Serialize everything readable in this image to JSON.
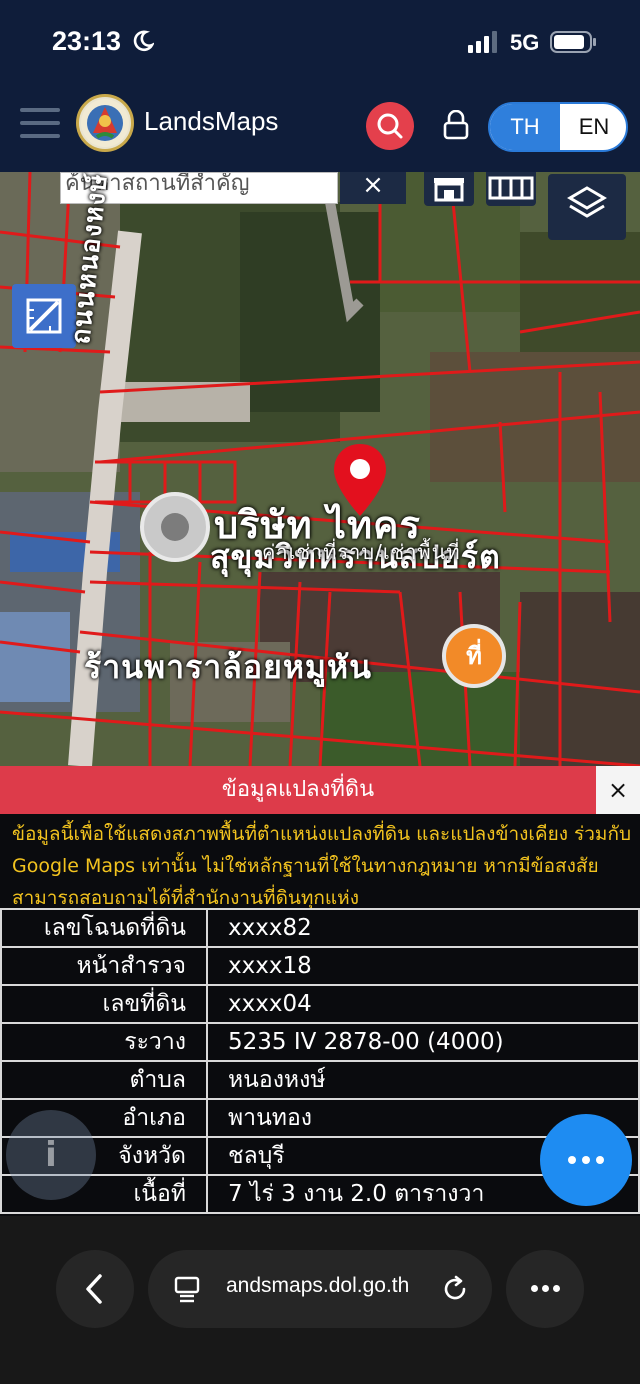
{
  "status_bar": {
    "time": "23:13",
    "network": "5G"
  },
  "header": {
    "app_title": "LandsMaps",
    "lang_th": "TH",
    "lang_en": "EN"
  },
  "map": {
    "search_placeholder": "ค้นหาสถานที่สำคัญ",
    "clear_symbol": "×",
    "label_company": "บริษัท ไทคร",
    "label_company_line2": "สุขุมวิทหรานสปอร์ต",
    "label_small": "ค่าเช่าที่ราบ/เช่าพื้นที่",
    "label_shop": "ร้านพาราล้อยหมูหัน",
    "label_side": "ถนนหนองหงษ์",
    "poi_symbol": "ที่"
  },
  "panel": {
    "title": "ข้อมูลแปลงที่ดิน",
    "close_symbol": "×",
    "notice": "ข้อมูลนี้เพื่อใช้แสดงสภาพพื้นที่ตำแหน่งแปลงที่ดิน และแปลงข้างเคียง ร่วมกับ Google Maps เท่านั้น ไม่ใช่หลักฐานที่ใช้ในทางกฎหมาย หากมีข้อสงสัยสามารถสอบถามได้ที่สำนักงานที่ดินทุกแห่ง",
    "rows": [
      {
        "key": "เลขโฉนดที่ดิน",
        "value": "xxxx82"
      },
      {
        "key": "หน้าสำรวจ",
        "value": "xxxx18"
      },
      {
        "key": "เลขที่ดิน",
        "value": "xxxx04"
      },
      {
        "key": "ระวาง",
        "value": "5235 IV 2878-00 (4000)"
      },
      {
        "key": "ตำบล",
        "value": "หนองหงษ์"
      },
      {
        "key": "อำเภอ",
        "value": "พานทอง"
      },
      {
        "key": "จังหวัด",
        "value": "ชลบุรี"
      },
      {
        "key": "เนื้อที่",
        "value": "7 ไร่ 3 งาน 2.0 ตารางวา"
      }
    ]
  },
  "fab": {
    "info_symbol": "i"
  },
  "browser": {
    "url": "andsmaps.dol.go.th"
  },
  "colors": {
    "accent_red": "#dd3b4a",
    "accent_blue": "#2f7fdc",
    "notice_yellow": "#f2c31f",
    "fab_blue": "#1e8cf2"
  }
}
